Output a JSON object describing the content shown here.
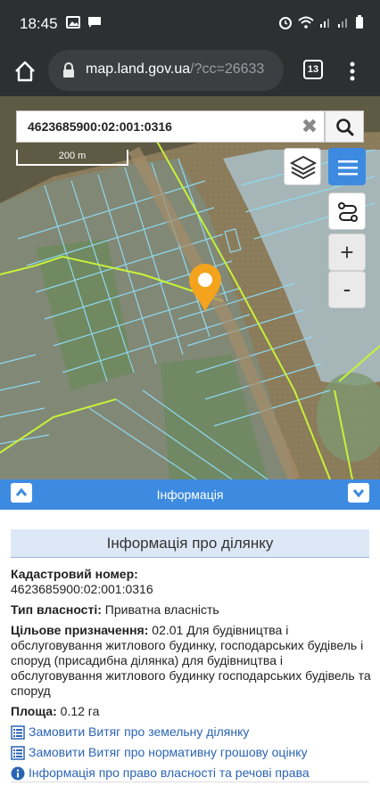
{
  "status_bar": {
    "time": "18:45"
  },
  "browser": {
    "url_host": "map.land.gov.ua",
    "url_path": "/?cc=26633",
    "tab_count": "13"
  },
  "map": {
    "search_value": "4623685900:02:001:0316",
    "clear_symbol": "✖",
    "scale_label": "200 m",
    "zoom_in": "+",
    "zoom_out": "-"
  },
  "info_header": {
    "title": "Інформація"
  },
  "parcel": {
    "title": "Інформація про ділянку",
    "cadastral_label": "Кадастровий номер:",
    "cadastral_value": "4623685900:02:001:0316",
    "ownership_label": "Тип власності:",
    "ownership_value": "Приватна власність",
    "purpose_label": "Цільове призначення:",
    "purpose_value": "02.01 Для будівництва і обслуговування житлового будинку, господарських будівель і споруд (присадибна ділянка) для будівництва і обслуговування житлового будинку господарських будівель та споруд",
    "area_label": "Площа:",
    "area_value": "0.12 га",
    "links": [
      {
        "label": "Замовити Витяг про земельну ділянку",
        "icon": "document-list-icon"
      },
      {
        "label": "Замовити Витяг про нормативну грошову оцінку",
        "icon": "document-list-icon"
      },
      {
        "label": "Інформація про право власності та речові права",
        "icon": "info-circle-icon"
      }
    ]
  },
  "colors": {
    "accent_blue": "#3d8be0",
    "pin_orange": "#f4a31c",
    "parcel_line": "#8fd8ef",
    "boundary_green": "#c6f23a",
    "link_blue": "#2b64b5"
  }
}
